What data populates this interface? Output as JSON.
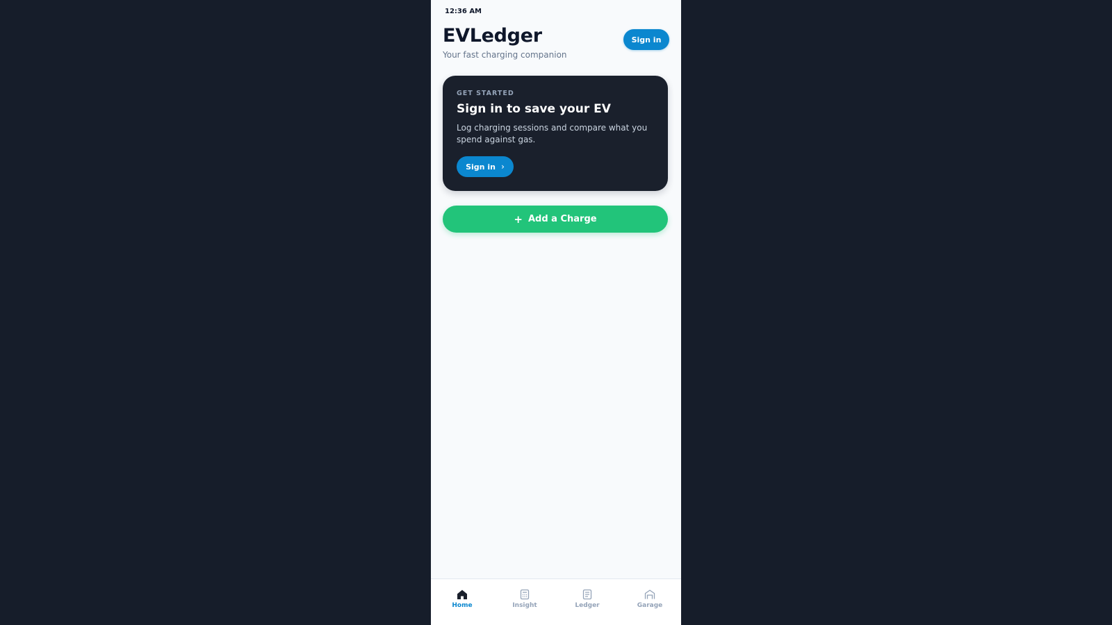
{
  "status_bar": {
    "time": "12:36 AM"
  },
  "header": {
    "title": "EVLedger",
    "subtitle": "Your fast charging companion",
    "signin_label": "Sign in"
  },
  "card": {
    "eyebrow": "GET STARTED",
    "heading": "Sign in to save your EV",
    "text": "Log charging sessions and compare what you spend against gas.",
    "button_label": "Sign in",
    "button_icon": "chevron-right-icon"
  },
  "add_charge": {
    "label": "Add a Charge",
    "icon": "plus-icon"
  },
  "nav": {
    "active": "Home",
    "items": [
      {
        "label": "Home",
        "icon": "home-icon"
      },
      {
        "label": "Insight",
        "icon": "calculator-icon"
      },
      {
        "label": "Ledger",
        "icon": "document-icon"
      },
      {
        "label": "Garage",
        "icon": "garage-icon"
      }
    ]
  },
  "colors": {
    "backdrop": "#161d2a",
    "accent": "#0b87cf",
    "success": "#22c47a",
    "card": "#1a202c",
    "text_primary": "#0f172a",
    "text_muted": "#64748b"
  }
}
